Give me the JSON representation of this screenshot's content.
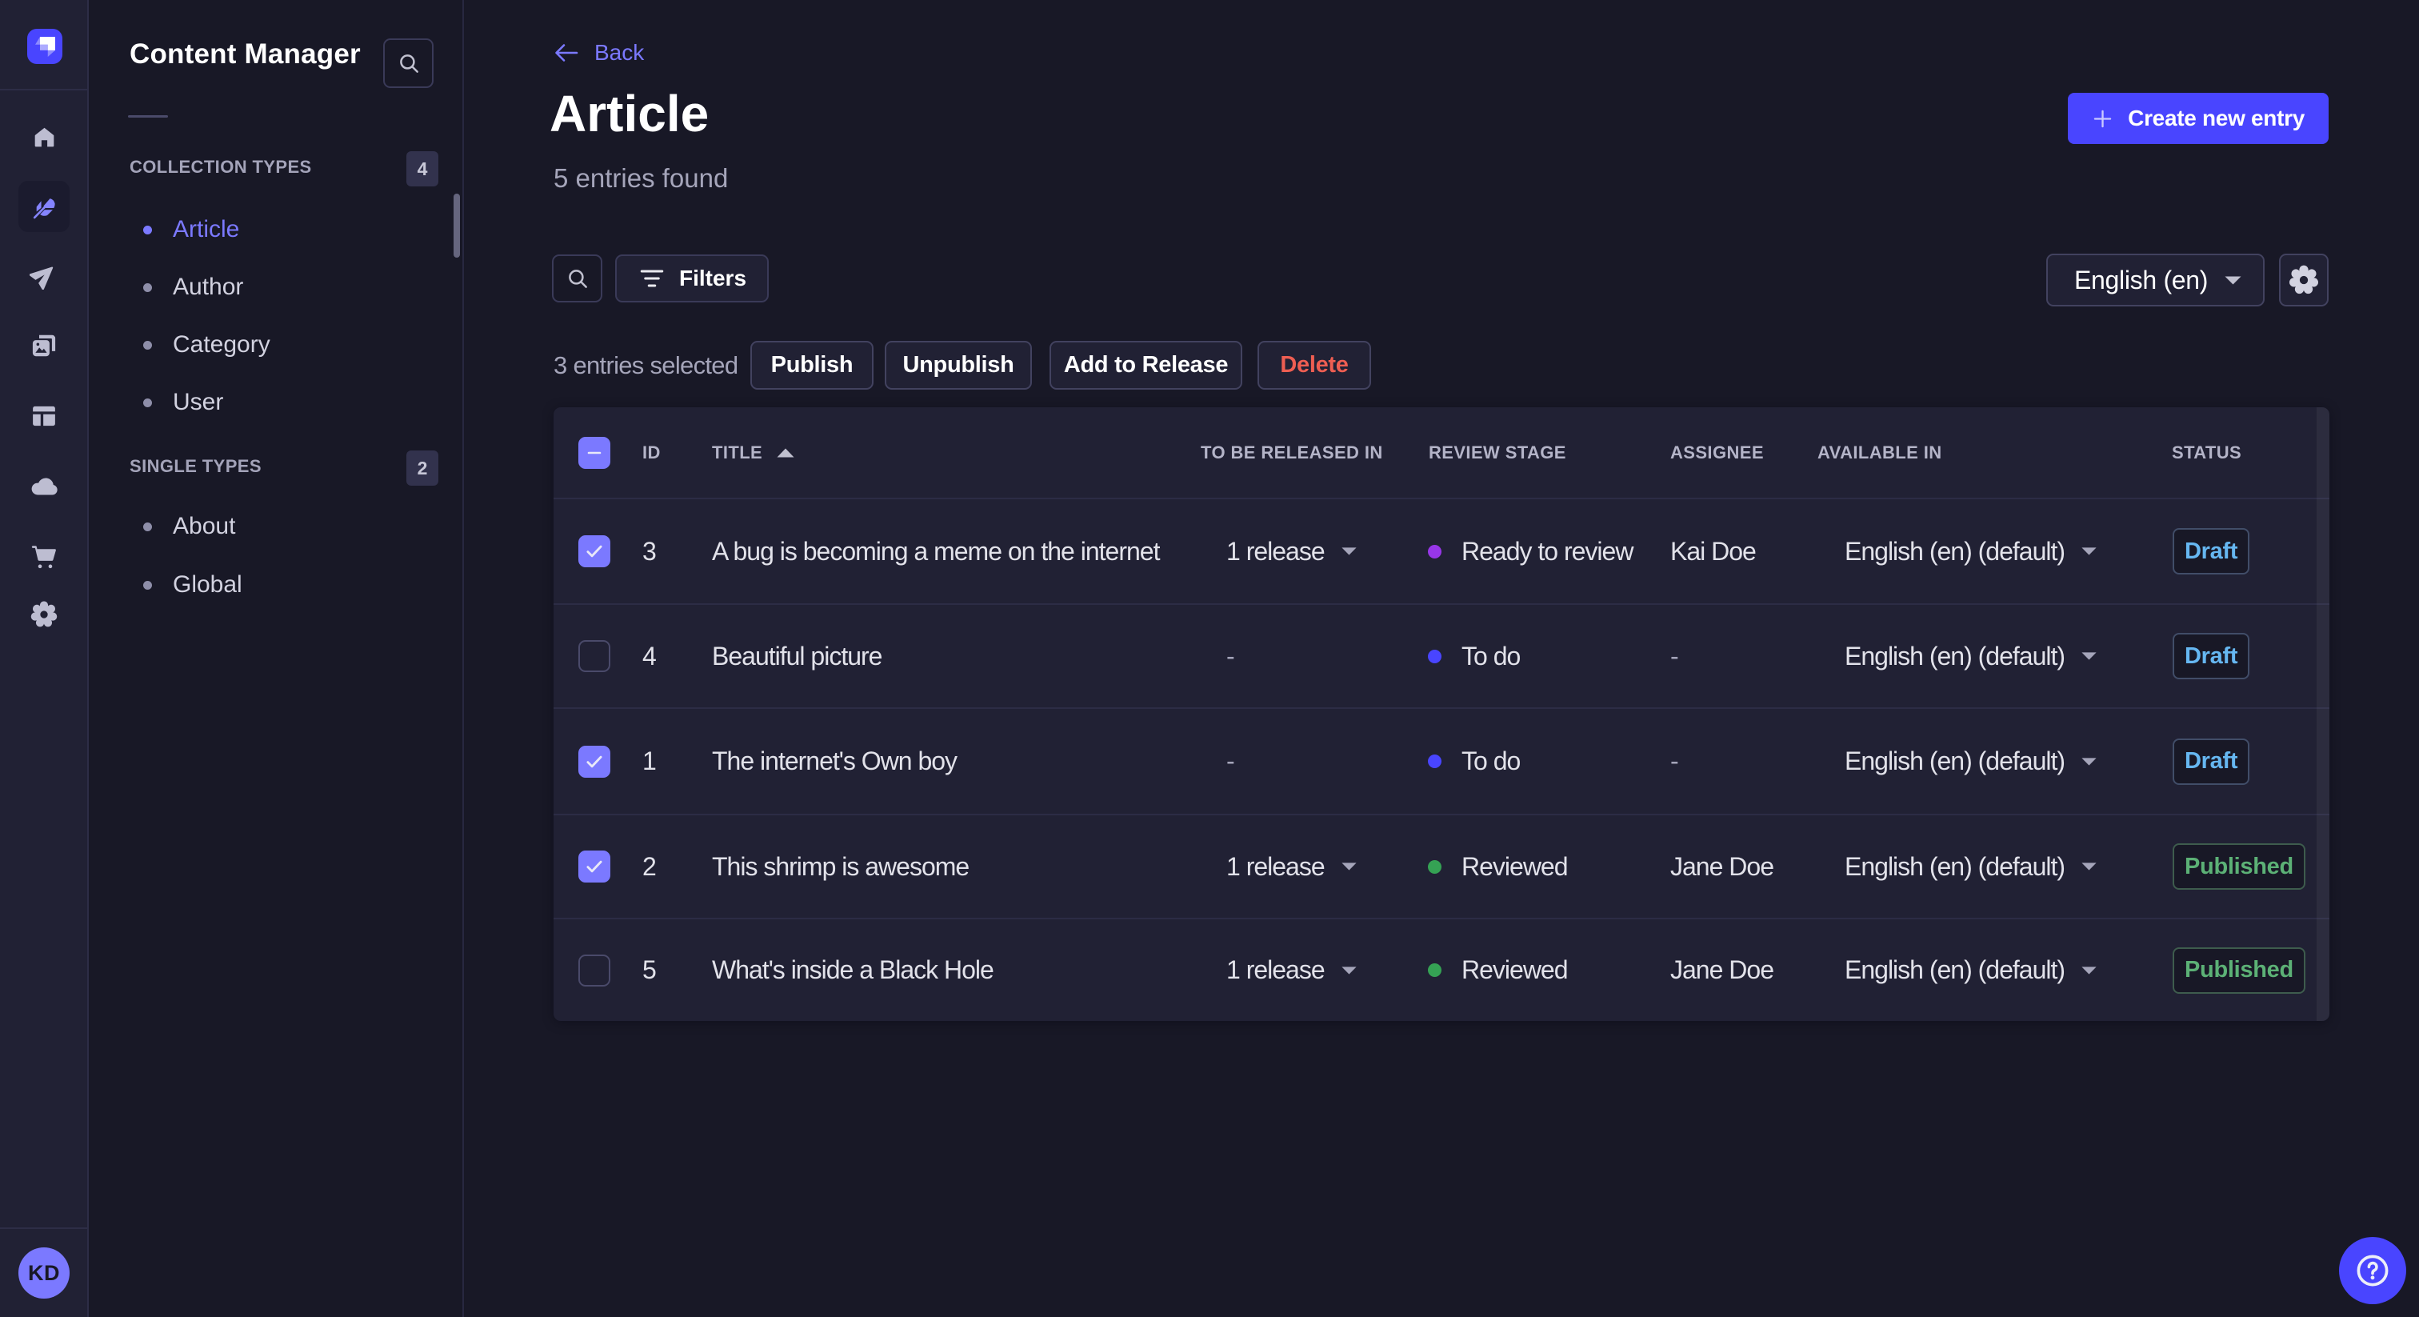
{
  "app": {
    "colors": {
      "accent": "#4945ff",
      "accent_light": "#7b79ff",
      "page_bg": "#181826",
      "surface_bg": "#212134",
      "danger": "#ee5e52",
      "draft": "#66b7f1",
      "published": "#5cb176"
    }
  },
  "rail": {
    "logo": "strapi-logo",
    "items": [
      {
        "icon": "home-icon",
        "active": false
      },
      {
        "icon": "feather-icon",
        "active": true
      },
      {
        "icon": "paper-plane-icon",
        "active": false
      },
      {
        "icon": "media-library-icon",
        "active": false
      },
      {
        "icon": "layout-icon",
        "active": false
      },
      {
        "icon": "cloud-icon",
        "active": false
      },
      {
        "icon": "cart-icon",
        "active": false
      },
      {
        "icon": "gear-icon",
        "active": false
      }
    ],
    "avatar_initials": "KD"
  },
  "subnav": {
    "title": "Content Manager",
    "sections": [
      {
        "label": "COLLECTION TYPES",
        "badge": "4",
        "items": [
          {
            "label": "Article",
            "active": true
          },
          {
            "label": "Author",
            "active": false
          },
          {
            "label": "Category",
            "active": false
          },
          {
            "label": "User",
            "active": false
          }
        ]
      },
      {
        "label": "SINGLE TYPES",
        "badge": "2",
        "items": [
          {
            "label": "About",
            "active": false
          },
          {
            "label": "Global",
            "active": false
          }
        ]
      }
    ]
  },
  "header": {
    "back_label": "Back",
    "title": "Article",
    "subtitle": "5 entries found",
    "create_label": "Create new entry"
  },
  "toolbar": {
    "filters_label": "Filters",
    "locale_value": "English (en)",
    "selected_info": "3 entries selected",
    "publish_label": "Publish",
    "unpublish_label": "Unpublish",
    "add_release_label": "Add to Release",
    "delete_label": "Delete"
  },
  "table": {
    "columns": {
      "id": "ID",
      "title": "TITLE",
      "released_in": "TO BE RELEASED IN",
      "review_stage": "REVIEW STAGE",
      "assignee": "ASSIGNEE",
      "available_in": "AVAILABLE IN",
      "status": "STATUS"
    },
    "header_checkbox": "indeterminate",
    "rows": [
      {
        "checked": true,
        "id": "3",
        "title": "A bug is becoming a meme on the internet",
        "released_in": "1 release",
        "stage": "Ready to review",
        "stage_color": "#9736e8",
        "assignee": "Kai Doe",
        "available_in": "English (en) (default)",
        "status": "Draft"
      },
      {
        "checked": false,
        "id": "4",
        "title": "Beautiful picture",
        "released_in": "-",
        "stage": "To do",
        "stage_color": "#4945ff",
        "assignee": "-",
        "available_in": "English (en) (default)",
        "status": "Draft"
      },
      {
        "checked": true,
        "id": "1",
        "title": "The internet's Own boy",
        "released_in": "-",
        "stage": "To do",
        "stage_color": "#4945ff",
        "assignee": "-",
        "available_in": "English (en) (default)",
        "status": "Draft"
      },
      {
        "checked": true,
        "id": "2",
        "title": "This shrimp is awesome",
        "released_in": "1 release",
        "stage": "Reviewed",
        "stage_color": "#35a254",
        "assignee": "Jane Doe",
        "available_in": "English (en) (default)",
        "status": "Published"
      },
      {
        "checked": false,
        "id": "5",
        "title": "What's inside a Black Hole",
        "released_in": "1 release",
        "stage": "Reviewed",
        "stage_color": "#35a254",
        "assignee": "Jane Doe",
        "available_in": "English (en) (default)",
        "status": "Published"
      }
    ]
  },
  "help": {
    "label": "help"
  }
}
